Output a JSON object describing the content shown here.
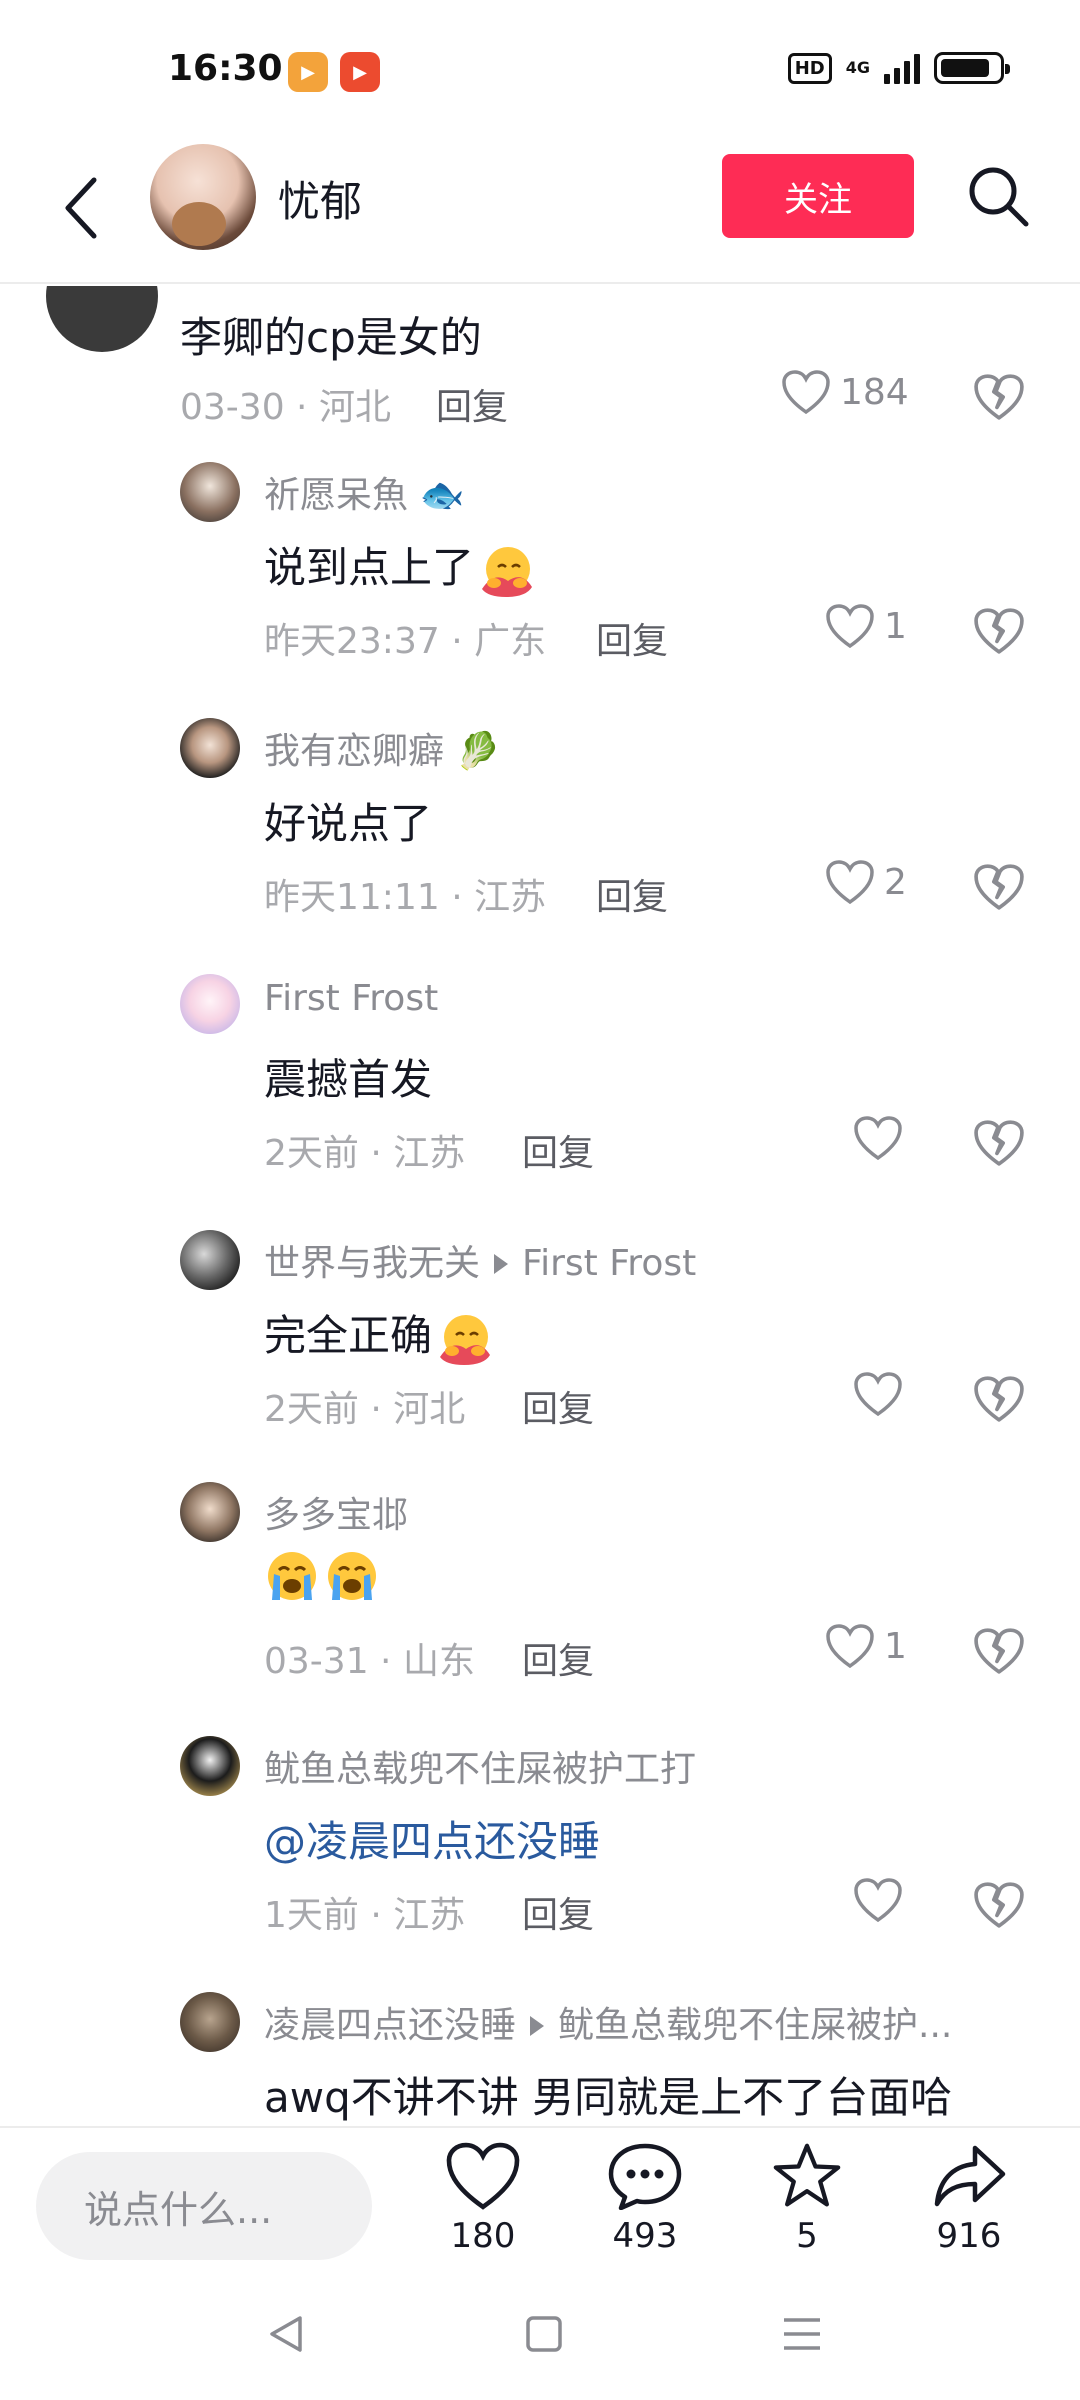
{
  "status_bar": {
    "time": "16:30",
    "hd_label": "HD",
    "network_label": "4G",
    "battery_level": 0.85
  },
  "header": {
    "back_icon": "chevron-left-icon",
    "username": "忧郁",
    "follow_label": "关注",
    "search_icon": "search-icon"
  },
  "parent_comment": {
    "text": "李卿的cp是女的",
    "meta": "03-30 · 河北",
    "reply_label": "回复",
    "likes": "184"
  },
  "replies": [
    {
      "name": "祈愿呆魚",
      "text": "说到点上了",
      "meta": "昨天23:37 · 广东",
      "reply_label": "回复",
      "likes": "1"
    },
    {
      "name": "我有恋卿癖",
      "text": "好说点了",
      "meta": "昨天11:11 · 江苏",
      "reply_label": "回复",
      "likes": "2"
    },
    {
      "name": "First Frost",
      "text": "震撼首发",
      "meta": "2天前 · 江苏",
      "reply_label": "回复",
      "likes": ""
    },
    {
      "name": "世界与我无关",
      "reply_to": "First Frost",
      "text": "完全正确",
      "meta": "2天前 · 河北",
      "reply_label": "回复",
      "likes": ""
    },
    {
      "name": "多多宝邶",
      "text": "",
      "meta": "03-31 · 山东",
      "reply_label": "回复",
      "likes": "1"
    },
    {
      "name": "鱿鱼总载兜不住屎被护工打",
      "text": "@凌晨四点还没睡",
      "meta": "1天前 · 江苏",
      "reply_label": "回复",
      "likes": ""
    },
    {
      "name": "凌晨四点还没睡",
      "reply_to": "鱿鱼总载兜不住屎被护...",
      "text": "awq不讲不讲 男同就是上不了台面哈",
      "meta": "",
      "reply_label": "",
      "likes": ""
    }
  ],
  "bottom_bar": {
    "input_placeholder": "说点什么...",
    "like_count": "180",
    "comment_count": "493",
    "favorite_count": "5",
    "share_count": "916"
  },
  "colors": {
    "accent": "#fe2c55",
    "mention": "#2a5a9e",
    "meta_gray": "#a8a9ad"
  }
}
